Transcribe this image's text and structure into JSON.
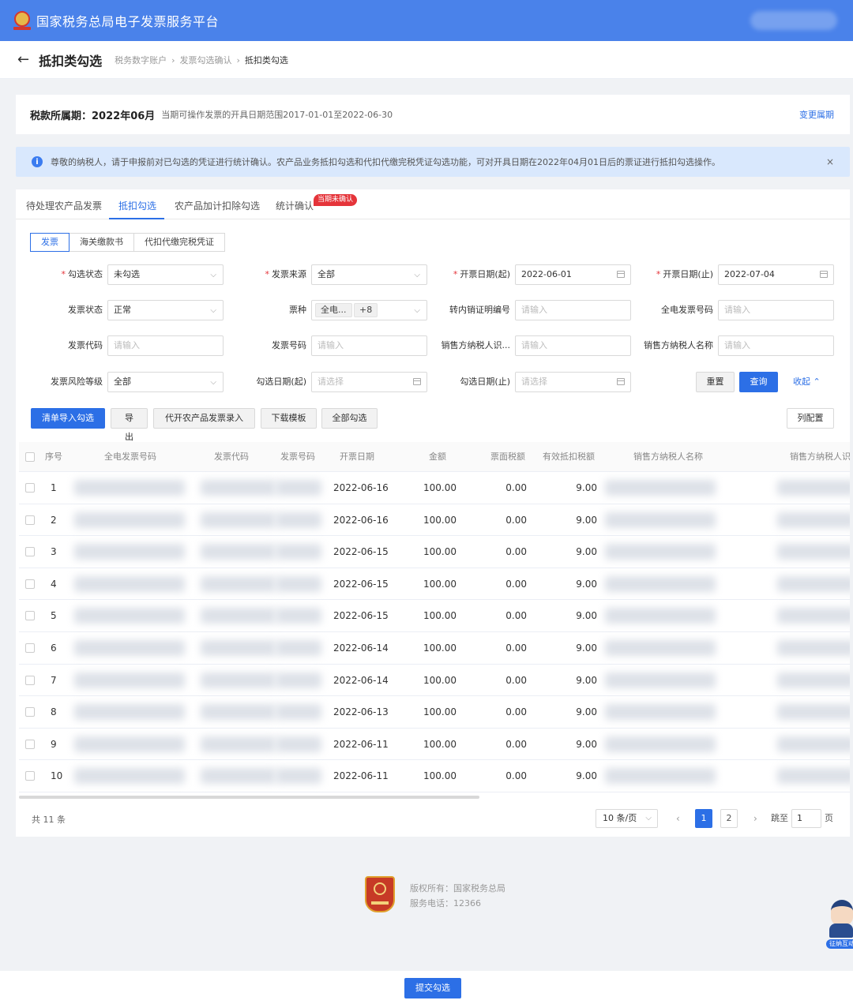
{
  "app": {
    "title": "国家税务总局电子发票服务平台"
  },
  "page": {
    "title": "抵扣类勾选",
    "breadcrumb": [
      "税务数字账户",
      "发票勾选确认",
      "抵扣类勾选"
    ]
  },
  "period": {
    "label": "税款所属期：",
    "value": "2022年06月",
    "range_text": "当期可操作发票的开具日期范围2017-01-01至2022-06-30",
    "change_link": "变更属期"
  },
  "notice": {
    "icon": "info-icon",
    "text": "尊敬的纳税人，请于申报前对已勾选的凭证进行统计确认。农产品业务抵扣勾选和代扣代缴完税凭证勾选功能，可对开具日期在2022年04月01日后的票证进行抵扣勾选操作。",
    "close": "×"
  },
  "tabs": [
    {
      "label": "待处理农产品发票"
    },
    {
      "label": "抵扣勾选"
    },
    {
      "label": "农产品加计扣除勾选"
    },
    {
      "label": "统计确认"
    }
  ],
  "tab_badge": "当期未确认",
  "subtabs": [
    {
      "label": "发票"
    },
    {
      "label": "海关缴款书"
    },
    {
      "label": "代扣代缴完税凭证"
    }
  ],
  "filters": {
    "check_status": {
      "label": "勾选状态",
      "value": "未勾选"
    },
    "invoice_source": {
      "label": "发票来源",
      "value": "全部"
    },
    "issue_date_start": {
      "label": "开票日期(起)",
      "value": "2022-06-01"
    },
    "issue_date_end": {
      "label": "开票日期(止)",
      "value": "2022-07-04"
    },
    "invoice_status": {
      "label": "发票状态",
      "value": "正常"
    },
    "ticket_type": {
      "label": "票种",
      "tag1": "全电...",
      "tag2": "+8"
    },
    "transfer_no": {
      "label": "转内销证明编号",
      "placeholder": "请输入"
    },
    "e_invoice_no": {
      "label": "全电发票号码",
      "placeholder": "请输入"
    },
    "invoice_code": {
      "label": "发票代码",
      "placeholder": "请输入"
    },
    "invoice_no": {
      "label": "发票号码",
      "placeholder": "请输入"
    },
    "seller_tax_id": {
      "label": "销售方纳税人识...",
      "placeholder": "请输入"
    },
    "seller_name": {
      "label": "销售方纳税人名称",
      "placeholder": "请输入"
    },
    "risk_level": {
      "label": "发票风险等级",
      "value": "全部"
    },
    "check_date_start": {
      "label": "勾选日期(起)",
      "placeholder": "请选择"
    },
    "check_date_end": {
      "label": "勾选日期(止)",
      "placeholder": "请选择"
    }
  },
  "filter_actions": {
    "reset": "重置",
    "query": "查询",
    "collapse": "收起"
  },
  "toolbar": {
    "import_check": "清单导入勾选",
    "export": "导出",
    "agri_entry": "代开农产品发票录入",
    "download_template": "下载模板",
    "check_all": "全部勾选",
    "column_config": "列配置"
  },
  "table": {
    "columns": [
      "序号",
      "全电发票号码",
      "发票代码",
      "发票号码",
      "开票日期",
      "金额",
      "票面税额",
      "有效抵扣税额",
      "销售方纳税人名称",
      "销售方纳税人识"
    ],
    "rows": [
      {
        "no": "1",
        "date": "2022-06-16",
        "amount": "100.00",
        "tax": "0.00",
        "deductible": "9.00"
      },
      {
        "no": "2",
        "date": "2022-06-16",
        "amount": "100.00",
        "tax": "0.00",
        "deductible": "9.00"
      },
      {
        "no": "3",
        "date": "2022-06-15",
        "amount": "100.00",
        "tax": "0.00",
        "deductible": "9.00"
      },
      {
        "no": "4",
        "date": "2022-06-15",
        "amount": "100.00",
        "tax": "0.00",
        "deductible": "9.00"
      },
      {
        "no": "5",
        "date": "2022-06-15",
        "amount": "100.00",
        "tax": "0.00",
        "deductible": "9.00"
      },
      {
        "no": "6",
        "date": "2022-06-14",
        "amount": "100.00",
        "tax": "0.00",
        "deductible": "9.00"
      },
      {
        "no": "7",
        "date": "2022-06-14",
        "amount": "100.00",
        "tax": "0.00",
        "deductible": "9.00"
      },
      {
        "no": "8",
        "date": "2022-06-13",
        "amount": "100.00",
        "tax": "0.00",
        "deductible": "9.00"
      },
      {
        "no": "9",
        "date": "2022-06-11",
        "amount": "100.00",
        "tax": "0.00",
        "deductible": "9.00"
      },
      {
        "no": "10",
        "date": "2022-06-11",
        "amount": "100.00",
        "tax": "0.00",
        "deductible": "9.00"
      }
    ]
  },
  "pagination": {
    "total": "共 11 条",
    "page_size": "10 条/页",
    "pages": [
      "1",
      "2"
    ],
    "jump_label": "跳至",
    "jump_value": "1",
    "page_suffix": "页"
  },
  "footer": {
    "copyright": "版权所有：国家税务总局",
    "phone": "服务电话：12366"
  },
  "assistant": {
    "label": "征纳互动"
  },
  "submit": {
    "label": "提交勾选"
  }
}
